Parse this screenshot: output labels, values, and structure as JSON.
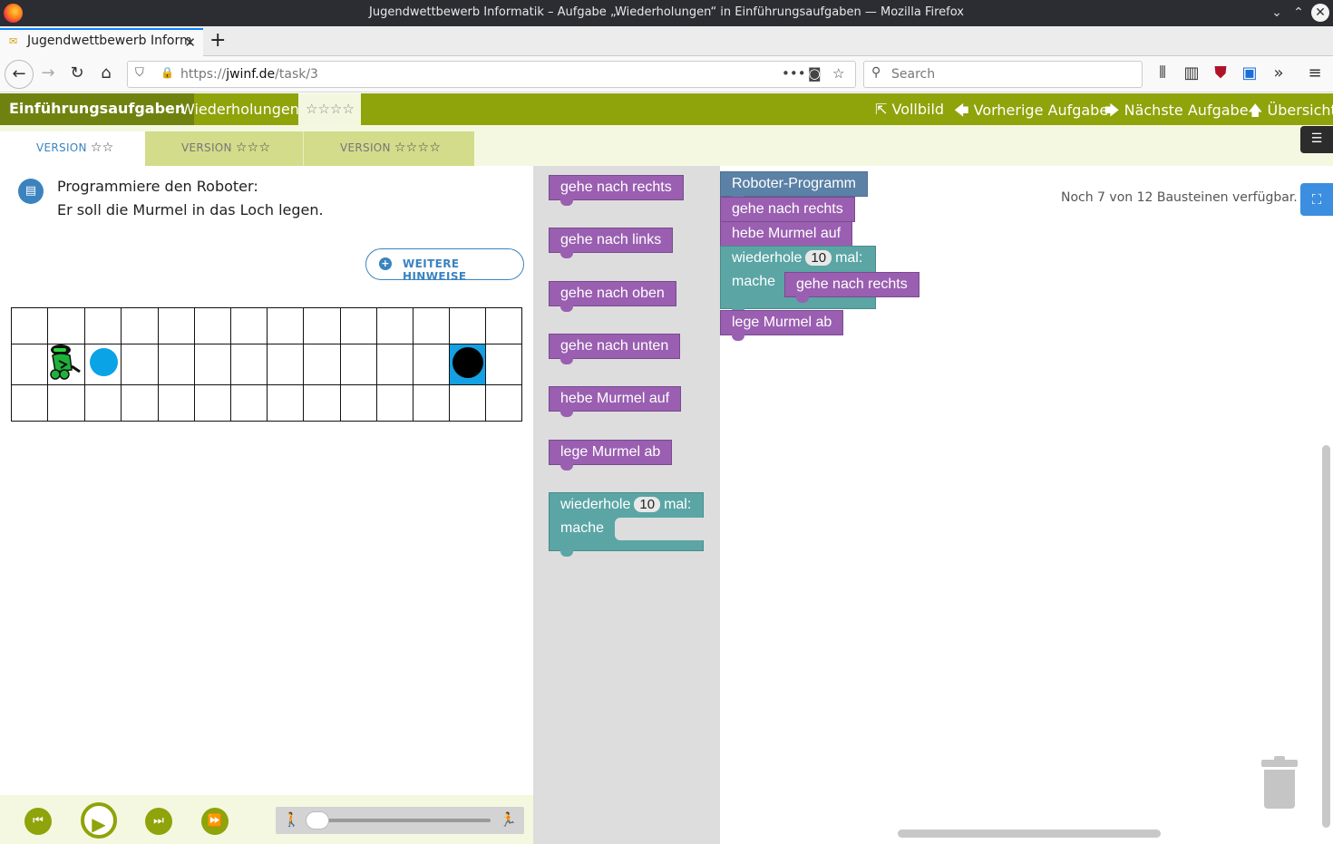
{
  "window": {
    "title": "Jugendwettbewerb Informatik – Aufgabe „Wiederholungen“ in Einführungsaufgaben — Mozilla Firefox"
  },
  "browser": {
    "tab_title": "Jugendwettbewerb Inform",
    "new_tab": "+",
    "url_prefix": "https://",
    "url_host": "jwinf.de",
    "url_path": "/task/3",
    "search_placeholder": "Search"
  },
  "header": {
    "course": "Einführungsaufgaben",
    "task": "Wiederholungen",
    "difficulty": "☆☆☆☆",
    "fullscreen": "⇱ Vollbild",
    "prev": "🡄 Vorherige Aufgabe",
    "next": "🡆 Nächste Aufgabe",
    "overview": "🡅 Übersicht"
  },
  "versions": [
    {
      "label": "VERSION",
      "stars": "☆☆"
    },
    {
      "label": "VERSION",
      "stars": "☆☆☆"
    },
    {
      "label": "VERSION",
      "stars": "☆☆☆☆"
    }
  ],
  "task": {
    "line1": "Programmiere den Roboter:",
    "line2": "Er soll die Murmel in das Loch legen.",
    "hints_button": "WEITERE HINWEISE"
  },
  "grid": {
    "rows": 3,
    "cols": 14,
    "robot": [
      1,
      1
    ],
    "marble": [
      1,
      2
    ],
    "hole": [
      1,
      12
    ]
  },
  "toolbox": {
    "blocks": [
      "gehe nach rechts",
      "gehe nach links",
      "gehe nach oben",
      "gehe nach unten",
      "hebe Murmel auf",
      "lege Murmel ab"
    ],
    "loop_label": "wiederhole",
    "loop_count": "10",
    "loop_suffix": "mal:",
    "loop_do": "mache"
  },
  "program": {
    "hat": "Roboter-Programm",
    "step1": "gehe nach rechts",
    "step2": "hebe Murmel auf",
    "loop_label": "wiederhole",
    "loop_count": "10",
    "loop_suffix": "mal:",
    "loop_do": "mache",
    "loop_body": "gehe nach rechts",
    "step3": "lege Murmel ab"
  },
  "workspace": {
    "counter": "Noch 7 von 12 Bausteinen verfügbar."
  }
}
